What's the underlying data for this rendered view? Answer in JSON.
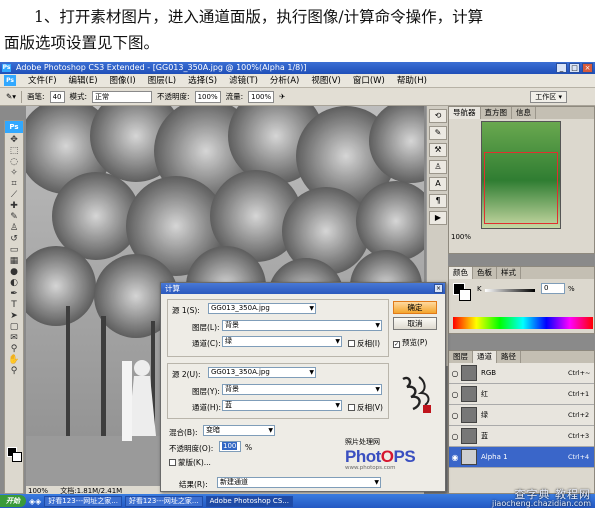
{
  "instruction": {
    "line1": "1、打开素材图片，进入通道面版，执行图像/计算命令操作，计算",
    "line2": "面版选项设置见下图。"
  },
  "window": {
    "title": "Adobe Photoshop CS3 Extended - [GG013_350A.jpg @ 100%(Alpha 1/8)]",
    "app_icon": "Ps"
  },
  "menu": [
    "文件(F)",
    "编辑(E)",
    "图像(I)",
    "图层(L)",
    "选择(S)",
    "滤镜(T)",
    "分析(A)",
    "视图(V)",
    "窗口(W)",
    "帮助(H)"
  ],
  "options": {
    "brush_label": "画笔:",
    "brush_size": "40",
    "mode_label": "模式:",
    "mode_value": "正常",
    "opacity_label": "不透明度:",
    "opacity_value": "100%",
    "flow_label": "流量:",
    "flow_value": "100%",
    "workspace": "工作区 ▾"
  },
  "navigator": {
    "tabs": [
      "导航器",
      "直方图",
      "信息"
    ],
    "zoom": "100%"
  },
  "color_panel": {
    "tabs": [
      "颜色",
      "色板",
      "样式"
    ],
    "channel": "K",
    "value": "0",
    "unit": "%"
  },
  "layers_panel": {
    "tabs": [
      "图层",
      "通道",
      "路径"
    ],
    "channels": [
      {
        "name": "RGB",
        "shortcut": "Ctrl+~",
        "selected": false
      },
      {
        "name": "红",
        "shortcut": "Ctrl+1",
        "selected": false
      },
      {
        "name": "绿",
        "shortcut": "Ctrl+2",
        "selected": false
      },
      {
        "name": "蓝",
        "shortcut": "Ctrl+3",
        "selected": false
      },
      {
        "name": "Alpha 1",
        "shortcut": "Ctrl+4",
        "selected": true
      }
    ]
  },
  "status": {
    "zoom": "100%",
    "doc": "文档:1.81M/2.41M"
  },
  "dialog": {
    "title": "计算",
    "source1_label": "源 1(S):",
    "source1_value": "GG013_350A.jpg",
    "layer1_label": "图层(L):",
    "layer1_value": "背景",
    "channel1_label": "通道(C):",
    "channel1_value": "绿",
    "invert1": "反相(I)",
    "source2_label": "源 2(U):",
    "source2_value": "GG013_350A.jpg",
    "layer2_label": "图层(Y):",
    "layer2_value": "背景",
    "channel2_label": "通道(H):",
    "channel2_value": "蓝",
    "invert2": "反相(V)",
    "blend_label": "混合(B):",
    "blend_value": "变暗",
    "opacity_label": "不透明度(O):",
    "opacity_value": "100",
    "opacity_unit": "%",
    "mask_label": "蒙版(K)...",
    "result_label": "结果(R):",
    "result_value": "新建通道",
    "ok": "确定",
    "cancel": "取消",
    "preview": "预览(P)",
    "brand_small": "照片处理网",
    "brand_big_1": "Phot",
    "brand_big_2": "O",
    "brand_big_3": "PS",
    "brand_url": "www.photops.com"
  },
  "taskbar": {
    "start": "开始",
    "tasks": [
      "好看123---网址之家...",
      "好看123---网址之家...",
      "Adobe Photoshop CS..."
    ]
  },
  "watermark": {
    "cn": "查字典 教程网",
    "url": "jiaocheng.chazidian.com"
  }
}
